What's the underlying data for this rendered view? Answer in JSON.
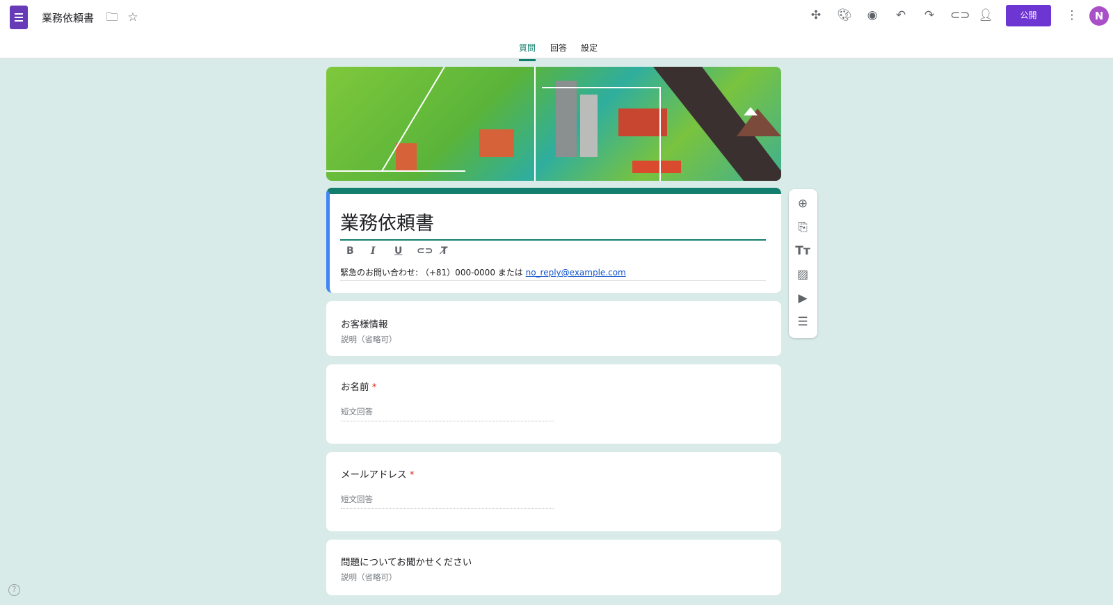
{
  "header": {
    "title": "業務依頼書",
    "publish": "公開",
    "avatar": "N"
  },
  "tabs": [
    {
      "label": "質問",
      "active": true
    },
    {
      "label": "回答"
    },
    {
      "label": "設定"
    }
  ],
  "form": {
    "title": "業務依頼書",
    "description_prefix": "緊急のお問い合わせ: （+81）000-0000 または ",
    "description_link": "no_reply@example.com"
  },
  "format_toolbar": {
    "bold": "B",
    "italic": "I",
    "underline": "U"
  },
  "sections": [
    {
      "title": "お客様情報",
      "description": "説明（省略可）"
    },
    {
      "title": "お名前",
      "required": "*",
      "placeholder": "短文回答"
    },
    {
      "title": "メールアドレス",
      "required": "*",
      "placeholder": "短文回答"
    },
    {
      "title": "問題についてお聞かせください",
      "description": "説明（省略可）"
    }
  ],
  "colors": {
    "accent": "#137e6e",
    "publish": "#6d35d2",
    "background": "#d9ebe8"
  }
}
